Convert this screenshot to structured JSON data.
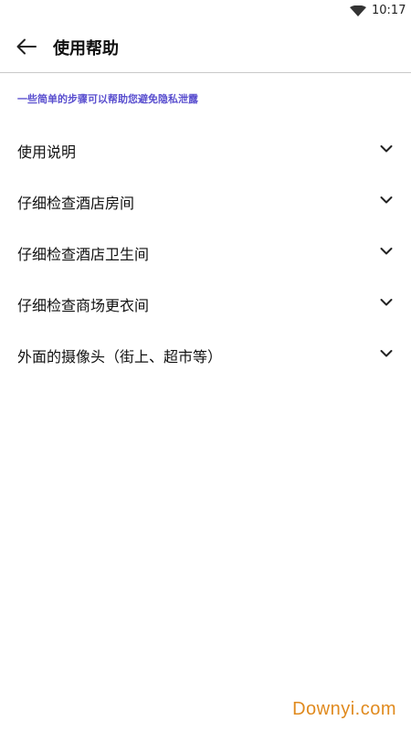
{
  "status_bar": {
    "time": "10:17",
    "wifi_icon": "wifi-icon"
  },
  "header": {
    "back_icon": "arrow-left-icon",
    "title": "使用帮助"
  },
  "subtitle": "一些简单的步骤可以帮助您避免隐私泄露",
  "colors": {
    "subtitle": "#5a4fcf",
    "divider": "#c9c9c9",
    "watermark": "#e08a1e"
  },
  "items": [
    {
      "label": "使用说明",
      "icon": "chevron-down-icon"
    },
    {
      "label": "仔细检查酒店房间",
      "icon": "chevron-down-icon"
    },
    {
      "label": "仔细检查酒店卫生间",
      "icon": "chevron-down-icon"
    },
    {
      "label": "仔细检查商场更衣间",
      "icon": "chevron-down-icon"
    },
    {
      "label": "外面的摄像头（街上、超市等）",
      "icon": "chevron-down-icon"
    }
  ],
  "watermark": "Downyi.com"
}
